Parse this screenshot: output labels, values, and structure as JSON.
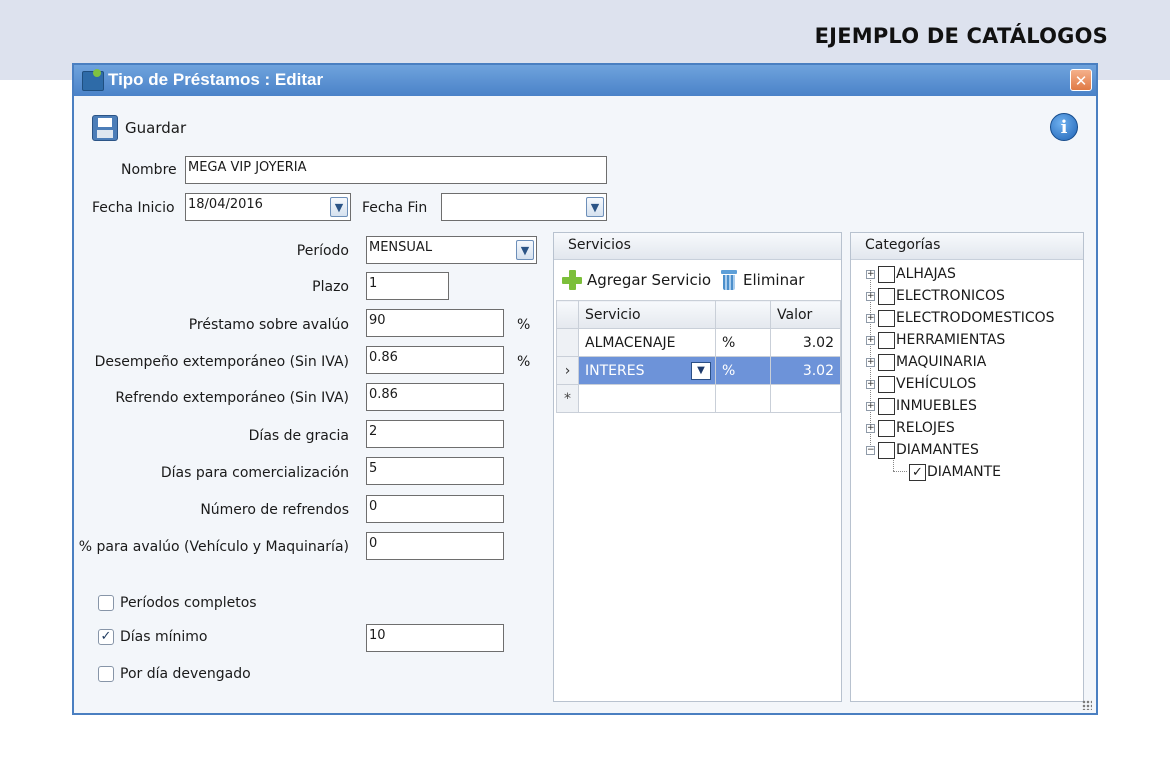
{
  "banner": {
    "title": "EJEMPLO DE CATÁLOGOS"
  },
  "window": {
    "title": "Tipo de Préstamos : Editar",
    "close_label": "✕"
  },
  "toolbar": {
    "save_label": "Guardar",
    "info_label": "i"
  },
  "form": {
    "nombre": {
      "label": "Nombre",
      "value": "MEGA VIP JOYERIA"
    },
    "fecha_inicio": {
      "label": "Fecha Inicio",
      "value": "18/04/2016"
    },
    "fecha_fin": {
      "label": "Fecha Fin",
      "value": ""
    },
    "periodo": {
      "label": "Período",
      "value": "MENSUAL"
    },
    "plazo": {
      "label": "Plazo",
      "value": "1"
    },
    "prestamo_avaluo": {
      "label": "Préstamo sobre avalúo",
      "value": "90",
      "unit": "%"
    },
    "desempeno": {
      "label": "Desempeño extemporáneo (Sin IVA)",
      "value": "0.86",
      "unit": "%"
    },
    "refrendo": {
      "label": "Refrendo extemporáneo (Sin IVA)",
      "value": "0.86"
    },
    "dias_gracia": {
      "label": "Días de gracia",
      "value": "2"
    },
    "dias_comercializacion": {
      "label": "Días para comercialización",
      "value": "5"
    },
    "numero_refrendos": {
      "label": "Número de refrendos",
      "value": "0"
    },
    "pct_avaluo": {
      "label": "% para avalúo (Vehículo y Maquinaría)",
      "value": "0"
    },
    "dias_minimo_value": "10"
  },
  "checkboxes": {
    "periodos_completos": {
      "label": "Períodos completos",
      "checked": false
    },
    "dias_minimo": {
      "label": "Días mínimo",
      "checked": true
    },
    "por_dia_devengado": {
      "label": "Por día devengado",
      "checked": false
    }
  },
  "servicios": {
    "title": "Servicios",
    "add_label": "Agregar Servicio",
    "delete_label": "Eliminar",
    "columns": [
      "Servicio",
      "",
      "Valor"
    ],
    "rows": [
      {
        "indicator": "",
        "servicio": "ALMACENAJE",
        "unit": "%",
        "valor": "3.02",
        "selected": false
      },
      {
        "indicator": "›",
        "servicio": "INTERES",
        "unit": "%",
        "valor": "3.02",
        "selected": true
      }
    ],
    "new_row_indicator": "*"
  },
  "categorias": {
    "title": "Categorías",
    "items": [
      {
        "label": "ALHAJAS",
        "checked": false,
        "expander": "+"
      },
      {
        "label": "ELECTRONICOS",
        "checked": false,
        "expander": "+"
      },
      {
        "label": "ELECTRODOMESTICOS",
        "checked": false,
        "expander": "+"
      },
      {
        "label": "HERRAMIENTAS",
        "checked": false,
        "expander": "+"
      },
      {
        "label": "MAQUINARIA",
        "checked": false,
        "expander": "+"
      },
      {
        "label": "VEHÍCULOS",
        "checked": false,
        "expander": "+"
      },
      {
        "label": "INMUEBLES",
        "checked": false,
        "expander": "+"
      },
      {
        "label": "RELOJES",
        "checked": false,
        "expander": "+"
      },
      {
        "label": "DIAMANTES",
        "checked": false,
        "expander": "−"
      }
    ],
    "child": {
      "label": "DIAMANTE",
      "checked": true
    }
  },
  "colors": {
    "title_bar": "#4a82c8",
    "selected_row": "#6d93d9",
    "accent_green": "#7cbf3a"
  }
}
